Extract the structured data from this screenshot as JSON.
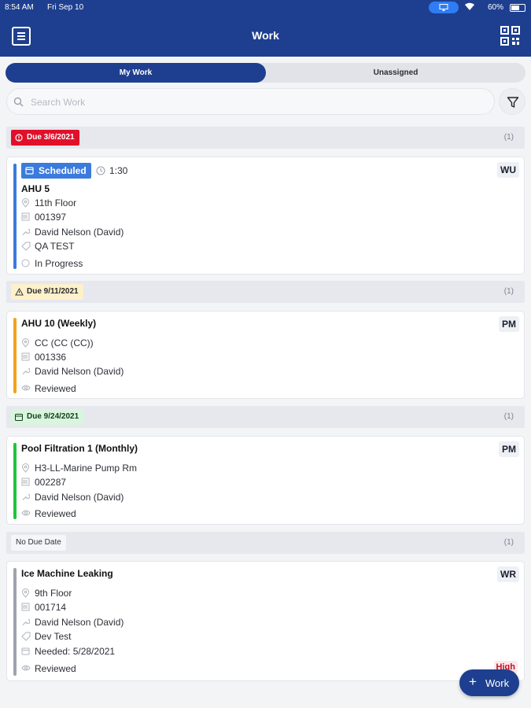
{
  "status_bar": {
    "time": "8:54 AM",
    "date": "Fri Sep 10",
    "battery": "60%"
  },
  "header": {
    "title": "Work"
  },
  "tabs": [
    {
      "label": "My Work",
      "active": true
    },
    {
      "label": "Unassigned",
      "active": false
    }
  ],
  "search": {
    "placeholder": "Search Work",
    "value": ""
  },
  "groups": [
    {
      "due_label": "Due 3/6/2021",
      "status": "overdue",
      "count": "(1)",
      "card": {
        "scheduled_label": "Scheduled",
        "duration": "1:30",
        "type": "WU",
        "name": "AHU 5",
        "location": "11th Floor",
        "id": "001397",
        "assignee": "David Nelson (David)",
        "tag": "QA TEST",
        "state": "In Progress",
        "stripe_color": "#3b7bdc"
      }
    },
    {
      "due_label": "Due 9/11/2021",
      "status": "warning",
      "count": "(1)",
      "card": {
        "type": "PM",
        "name": "AHU 10 (Weekly)",
        "location": "CC (CC (CC))",
        "id": "001336",
        "assignee": "David Nelson (David)",
        "state": "Reviewed",
        "stripe_color": "#f2a41f"
      }
    },
    {
      "due_label": "Due 9/24/2021",
      "status": "upcoming",
      "count": "(1)",
      "card": {
        "type": "PM",
        "name": "Pool Filtration 1 (Monthly)",
        "location": "H3-LL-Marine Pump Rm",
        "id": "002287",
        "assignee": "David Nelson (David)",
        "state": "Reviewed",
        "stripe_color": "#22c43c"
      }
    },
    {
      "due_label": "No Due Date",
      "status": "none",
      "count": "(1)",
      "card": {
        "type": "WR",
        "name": "Ice Machine Leaking",
        "location": "9th Floor",
        "id": "001714",
        "assignee": "David Nelson (David)",
        "tag": "Dev Test",
        "needed": "Needed: 5/28/2021",
        "state": "Reviewed",
        "priority": "High",
        "stripe_color": "#9ea3ad"
      }
    }
  ],
  "fab": {
    "label": "Work"
  }
}
